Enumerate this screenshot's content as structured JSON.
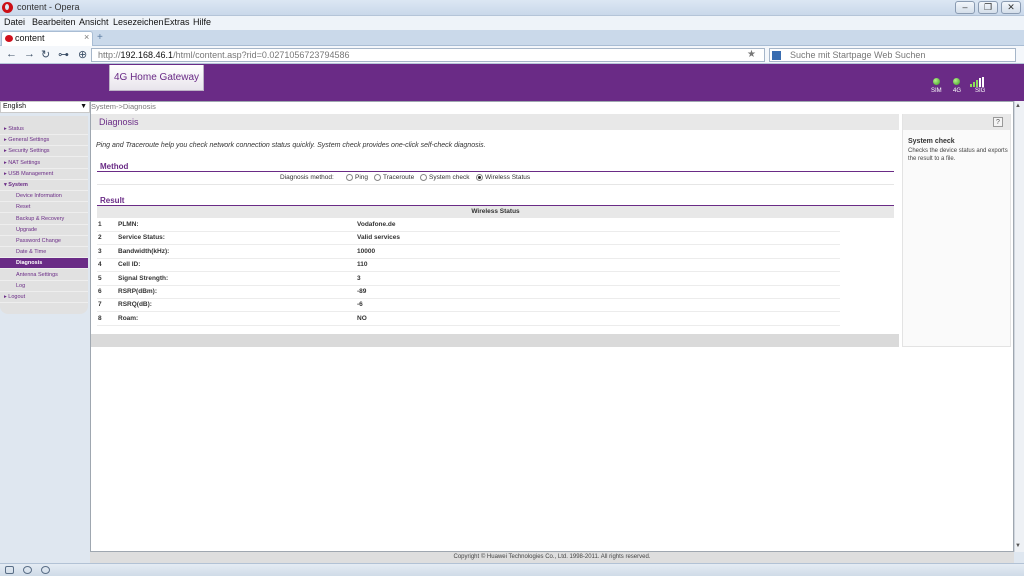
{
  "window": {
    "title": "content - Opera",
    "min": "–",
    "max": "❐",
    "close": "✕"
  },
  "menu": [
    "Datei",
    "Bearbeiten",
    "Ansicht",
    "Lesezeichen",
    "Extras",
    "Hilfe"
  ],
  "tab": {
    "label": "content",
    "close": "×",
    "new_tab": "+"
  },
  "address": {
    "back": "←",
    "forward": "→",
    "reload": "↻",
    "key": "⊶",
    "site": "⊕",
    "url_prefix": "http://",
    "url_host": "192.168.46.1",
    "url_path": "/html/content.asp?rid=0.0271056723794586",
    "star": "★",
    "search_placeholder": "Suche mit Startpage Web Suchen"
  },
  "router": {
    "product": "4G Home Gateway",
    "indicators": [
      "SIM",
      "4G",
      "SIG"
    ],
    "accent_color": "#6a2b86"
  },
  "language": {
    "selected": "English",
    "arrow": "▼"
  },
  "sidebar": {
    "items": [
      {
        "label": "▸ Status",
        "type": "main"
      },
      {
        "label": "▸ General Settings",
        "type": "main"
      },
      {
        "label": "▸ Security Settings",
        "type": "main"
      },
      {
        "label": "▸ NAT Settings",
        "type": "main"
      },
      {
        "label": "▸ USB Management",
        "type": "main"
      },
      {
        "label": "▾ System",
        "type": "open"
      },
      {
        "label": "Device Information",
        "type": "sub"
      },
      {
        "label": "Reset",
        "type": "sub"
      },
      {
        "label": "Backup & Recovery",
        "type": "sub"
      },
      {
        "label": "Upgrade",
        "type": "sub"
      },
      {
        "label": "Password Change",
        "type": "sub"
      },
      {
        "label": "Date & Time",
        "type": "sub"
      },
      {
        "label": "Diagnosis",
        "type": "active"
      },
      {
        "label": "Antenna Settings",
        "type": "sub"
      },
      {
        "label": "Log",
        "type": "sub"
      },
      {
        "label": "▸ Logout",
        "type": "main"
      }
    ]
  },
  "breadcrumb": "System->Diagnosis",
  "diagnosis": {
    "title": "Diagnosis",
    "description": "Ping and Traceroute help you check network connection status quickly. System check provides one-click self-check diagnosis.",
    "method_section": "Method",
    "method_label": "Diagnosis method:",
    "methods": [
      {
        "label": "Ping",
        "checked": false
      },
      {
        "label": "Traceroute",
        "checked": false
      },
      {
        "label": "System check",
        "checked": false
      },
      {
        "label": "Wireless Status",
        "checked": true
      }
    ],
    "result_section": "Result",
    "result_header": "Wireless Status",
    "rows": [
      {
        "num": "1",
        "key": "PLMN:",
        "value": "Vodafone.de"
      },
      {
        "num": "2",
        "key": "Service Status:",
        "value": "Valid services"
      },
      {
        "num": "3",
        "key": "Bandwidth(kHz):",
        "value": "10000"
      },
      {
        "num": "4",
        "key": "Cell ID:",
        "value": "110"
      },
      {
        "num": "5",
        "key": "Signal Strength:",
        "value": "3"
      },
      {
        "num": "6",
        "key": "RSRP(dBm):",
        "value": "-89"
      },
      {
        "num": "7",
        "key": "RSRQ(dB):",
        "value": "-6"
      },
      {
        "num": "8",
        "key": "Roam:",
        "value": "NO"
      }
    ]
  },
  "help": {
    "icon": "?",
    "title": "System check",
    "text": "Checks the device status and exports the result to a file."
  },
  "footer": {
    "copyright": "Copyright © Huawei Technologies Co., Ltd. 1998-2011. All rights reserved."
  },
  "scroll": {
    "up": "▲",
    "down": "▼"
  }
}
